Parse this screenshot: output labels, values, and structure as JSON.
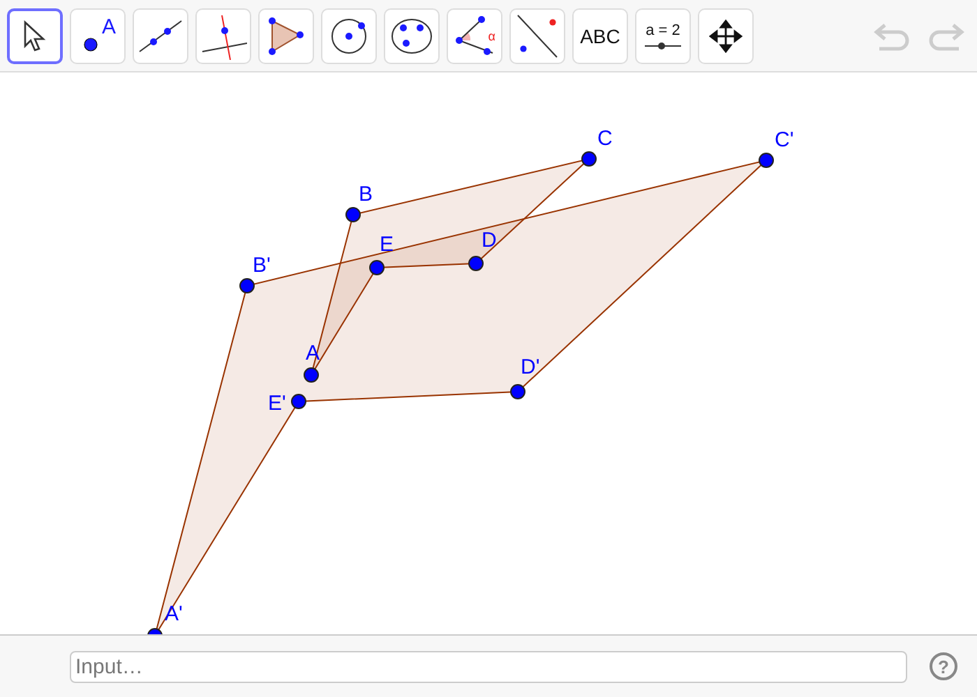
{
  "toolbar": {
    "tools": [
      {
        "kind": "move",
        "selected": true
      },
      {
        "kind": "point",
        "selected": false,
        "text": "A"
      },
      {
        "kind": "line",
        "selected": false
      },
      {
        "kind": "perpendicular",
        "selected": false
      },
      {
        "kind": "polygon",
        "selected": false
      },
      {
        "kind": "circle",
        "selected": false
      },
      {
        "kind": "conic",
        "selected": false
      },
      {
        "kind": "angle",
        "selected": false,
        "text": "α"
      },
      {
        "kind": "reflect",
        "selected": false
      },
      {
        "kind": "text",
        "selected": false,
        "text": "ABC"
      },
      {
        "kind": "slider",
        "selected": false,
        "text": "a = 2"
      },
      {
        "kind": "move-view",
        "selected": false
      }
    ],
    "undo": {
      "disabled": true
    },
    "redo": {
      "disabled": true
    }
  },
  "figures": [
    {
      "points": [
        {
          "label": "A"
        },
        {
          "label": "B"
        },
        {
          "label": "C"
        },
        {
          "label": "D"
        },
        {
          "label": "E"
        }
      ]
    },
    {
      "points": [
        {
          "label": "A'"
        },
        {
          "label": "B'"
        },
        {
          "label": "C'"
        },
        {
          "label": "D'"
        },
        {
          "label": "E'"
        }
      ]
    }
  ],
  "input_bar": {
    "placeholder": "Input…",
    "help": "?"
  }
}
